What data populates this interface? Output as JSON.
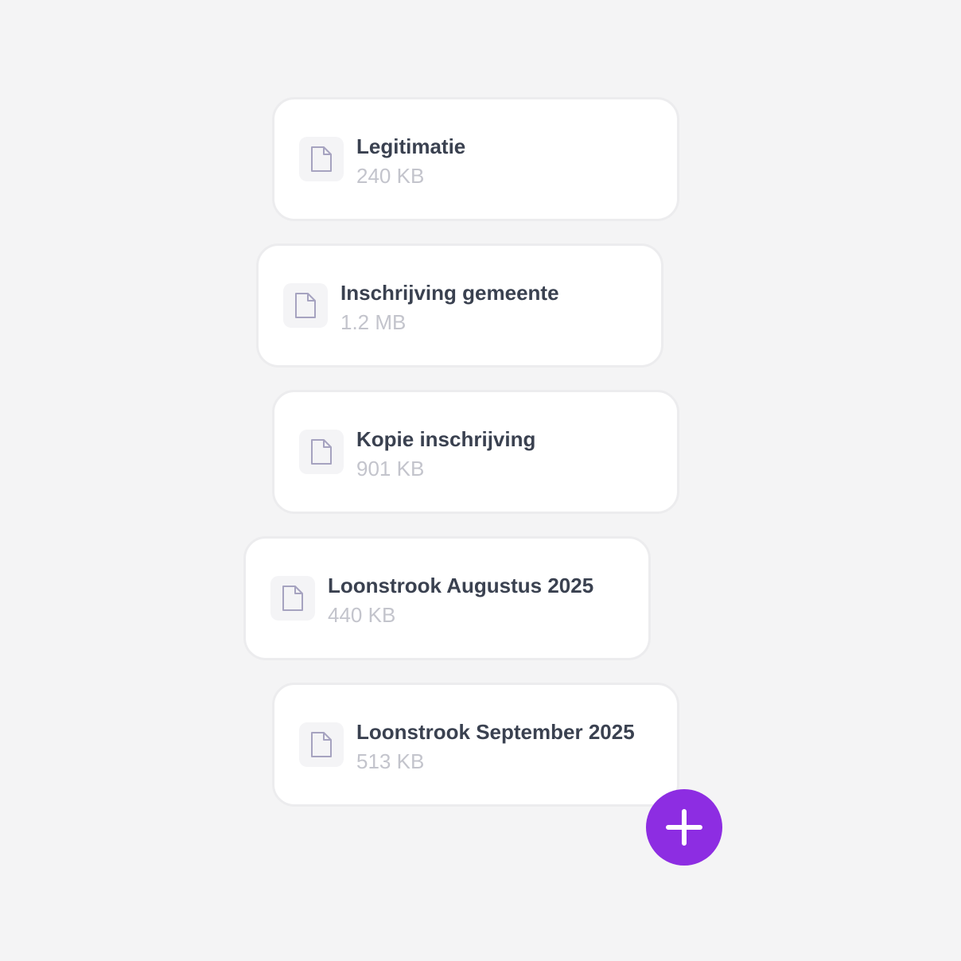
{
  "files": [
    {
      "name": "Legitimatie",
      "size": "240 KB",
      "icon": "document-icon"
    },
    {
      "name": "Inschrijving gemeente",
      "size": "1.2 MB",
      "icon": "document-icon"
    },
    {
      "name": "Kopie inschrijving",
      "size": "901 KB",
      "icon": "document-icon"
    },
    {
      "name": "Loonstrook Augustus 2025",
      "size": "440 KB",
      "icon": "document-icon"
    },
    {
      "name": "Loonstrook September 2025",
      "size": "513 KB",
      "icon": "document-icon"
    }
  ],
  "add_button": {
    "icon": "plus-icon",
    "color": "#8d2de2"
  },
  "colors": {
    "background": "#f4f4f5",
    "card": "#ffffff",
    "title_text": "#3a4150",
    "size_text": "#c3c4cc",
    "icon_stroke": "#a6a3c0"
  }
}
